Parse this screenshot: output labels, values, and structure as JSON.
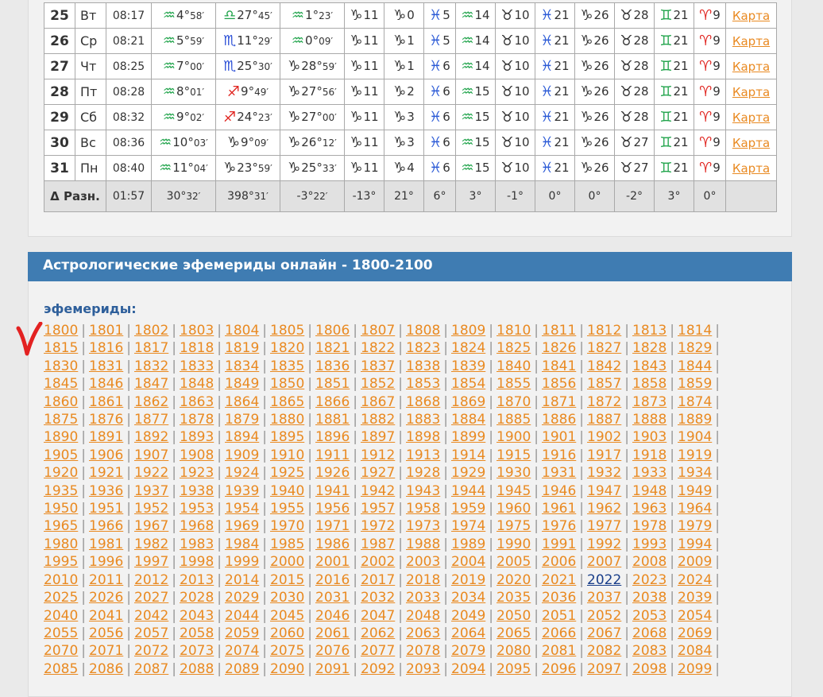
{
  "table": {
    "rows": [
      {
        "day": "25",
        "dow": "Вт",
        "time": "08:17",
        "cells": [
          {
            "sign": "aquarius",
            "deg": "4°",
            "min": "58′"
          },
          {
            "sign": "libra",
            "deg": "27°",
            "min": "45′"
          },
          {
            "sign": "aquarius",
            "deg": "1°",
            "min": "23′"
          },
          {
            "sign": "capricorn",
            "deg": "11",
            "min": ""
          },
          {
            "sign": "capricorn",
            "deg": "0",
            "min": ""
          },
          {
            "sign": "pisces",
            "deg": "5",
            "min": ""
          },
          {
            "sign": "aquarius",
            "deg": "14",
            "min": ""
          },
          {
            "sign": "taurus",
            "deg": "10",
            "min": ""
          },
          {
            "sign": "pisces",
            "deg": "21",
            "min": ""
          },
          {
            "sign": "capricorn",
            "deg": "26",
            "min": ""
          },
          {
            "sign": "taurus",
            "deg": "28",
            "min": ""
          },
          {
            "sign": "gemini",
            "deg": "21",
            "min": ""
          },
          {
            "sign": "aries",
            "deg": "9",
            "min": ""
          }
        ],
        "map": "Карта"
      },
      {
        "day": "26",
        "dow": "Ср",
        "time": "08:21",
        "cells": [
          {
            "sign": "aquarius",
            "deg": "5°",
            "min": "59′"
          },
          {
            "sign": "scorpio",
            "deg": "11°",
            "min": "29′"
          },
          {
            "sign": "aquarius",
            "deg": "0°",
            "min": "09′"
          },
          {
            "sign": "capricorn",
            "deg": "11",
            "min": ""
          },
          {
            "sign": "capricorn",
            "deg": "1",
            "min": ""
          },
          {
            "sign": "pisces",
            "deg": "5",
            "min": ""
          },
          {
            "sign": "aquarius",
            "deg": "14",
            "min": ""
          },
          {
            "sign": "taurus",
            "deg": "10",
            "min": ""
          },
          {
            "sign": "pisces",
            "deg": "21",
            "min": ""
          },
          {
            "sign": "capricorn",
            "deg": "26",
            "min": ""
          },
          {
            "sign": "taurus",
            "deg": "28",
            "min": ""
          },
          {
            "sign": "gemini",
            "deg": "21",
            "min": ""
          },
          {
            "sign": "aries",
            "deg": "9",
            "min": ""
          }
        ],
        "map": "Карта"
      },
      {
        "day": "27",
        "dow": "Чт",
        "time": "08:25",
        "cells": [
          {
            "sign": "aquarius",
            "deg": "7°",
            "min": "00′"
          },
          {
            "sign": "scorpio",
            "deg": "25°",
            "min": "30′"
          },
          {
            "sign": "capricorn",
            "deg": "28°",
            "min": "59′"
          },
          {
            "sign": "capricorn",
            "deg": "11",
            "min": ""
          },
          {
            "sign": "capricorn",
            "deg": "1",
            "min": ""
          },
          {
            "sign": "pisces",
            "deg": "6",
            "min": ""
          },
          {
            "sign": "aquarius",
            "deg": "14",
            "min": ""
          },
          {
            "sign": "taurus",
            "deg": "10",
            "min": ""
          },
          {
            "sign": "pisces",
            "deg": "21",
            "min": ""
          },
          {
            "sign": "capricorn",
            "deg": "26",
            "min": ""
          },
          {
            "sign": "taurus",
            "deg": "28",
            "min": ""
          },
          {
            "sign": "gemini",
            "deg": "21",
            "min": ""
          },
          {
            "sign": "aries",
            "deg": "9",
            "min": ""
          }
        ],
        "map": "Карта"
      },
      {
        "day": "28",
        "dow": "Пт",
        "time": "08:28",
        "cells": [
          {
            "sign": "aquarius",
            "deg": "8°",
            "min": "01′"
          },
          {
            "sign": "sagittarius",
            "deg": "9°",
            "min": "49′"
          },
          {
            "sign": "capricorn",
            "deg": "27°",
            "min": "56′"
          },
          {
            "sign": "capricorn",
            "deg": "11",
            "min": ""
          },
          {
            "sign": "capricorn",
            "deg": "2",
            "min": ""
          },
          {
            "sign": "pisces",
            "deg": "6",
            "min": ""
          },
          {
            "sign": "aquarius",
            "deg": "15",
            "min": ""
          },
          {
            "sign": "taurus",
            "deg": "10",
            "min": ""
          },
          {
            "sign": "pisces",
            "deg": "21",
            "min": ""
          },
          {
            "sign": "capricorn",
            "deg": "26",
            "min": ""
          },
          {
            "sign": "taurus",
            "deg": "28",
            "min": ""
          },
          {
            "sign": "gemini",
            "deg": "21",
            "min": ""
          },
          {
            "sign": "aries",
            "deg": "9",
            "min": ""
          }
        ],
        "map": "Карта"
      },
      {
        "day": "29",
        "dow": "Сб",
        "time": "08:32",
        "cells": [
          {
            "sign": "aquarius",
            "deg": "9°",
            "min": "02′"
          },
          {
            "sign": "sagittarius",
            "deg": "24°",
            "min": "23′"
          },
          {
            "sign": "capricorn",
            "deg": "27°",
            "min": "00′"
          },
          {
            "sign": "capricorn",
            "deg": "11",
            "min": ""
          },
          {
            "sign": "capricorn",
            "deg": "3",
            "min": ""
          },
          {
            "sign": "pisces",
            "deg": "6",
            "min": ""
          },
          {
            "sign": "aquarius",
            "deg": "15",
            "min": ""
          },
          {
            "sign": "taurus",
            "deg": "10",
            "min": ""
          },
          {
            "sign": "pisces",
            "deg": "21",
            "min": ""
          },
          {
            "sign": "capricorn",
            "deg": "26",
            "min": ""
          },
          {
            "sign": "taurus",
            "deg": "28",
            "min": ""
          },
          {
            "sign": "gemini",
            "deg": "21",
            "min": ""
          },
          {
            "sign": "aries",
            "deg": "9",
            "min": ""
          }
        ],
        "map": "Карта"
      },
      {
        "day": "30",
        "dow": "Вс",
        "time": "08:36",
        "cells": [
          {
            "sign": "aquarius",
            "deg": "10°",
            "min": "03′"
          },
          {
            "sign": "capricorn",
            "deg": "9°",
            "min": "09′"
          },
          {
            "sign": "capricorn",
            "deg": "26°",
            "min": "12′"
          },
          {
            "sign": "capricorn",
            "deg": "11",
            "min": ""
          },
          {
            "sign": "capricorn",
            "deg": "3",
            "min": ""
          },
          {
            "sign": "pisces",
            "deg": "6",
            "min": ""
          },
          {
            "sign": "aquarius",
            "deg": "15",
            "min": ""
          },
          {
            "sign": "taurus",
            "deg": "10",
            "min": ""
          },
          {
            "sign": "pisces",
            "deg": "21",
            "min": ""
          },
          {
            "sign": "capricorn",
            "deg": "26",
            "min": ""
          },
          {
            "sign": "taurus",
            "deg": "27",
            "min": ""
          },
          {
            "sign": "gemini",
            "deg": "21",
            "min": ""
          },
          {
            "sign": "aries",
            "deg": "9",
            "min": ""
          }
        ],
        "map": "Карта"
      },
      {
        "day": "31",
        "dow": "Пн",
        "time": "08:40",
        "cells": [
          {
            "sign": "aquarius",
            "deg": "11°",
            "min": "04′"
          },
          {
            "sign": "capricorn",
            "deg": "23°",
            "min": "59′"
          },
          {
            "sign": "capricorn",
            "deg": "25°",
            "min": "33′"
          },
          {
            "sign": "capricorn",
            "deg": "11",
            "min": ""
          },
          {
            "sign": "capricorn",
            "deg": "4",
            "min": ""
          },
          {
            "sign": "pisces",
            "deg": "6",
            "min": ""
          },
          {
            "sign": "aquarius",
            "deg": "15",
            "min": ""
          },
          {
            "sign": "taurus",
            "deg": "10",
            "min": ""
          },
          {
            "sign": "pisces",
            "deg": "21",
            "min": ""
          },
          {
            "sign": "capricorn",
            "deg": "26",
            "min": ""
          },
          {
            "sign": "taurus",
            "deg": "27",
            "min": ""
          },
          {
            "sign": "gemini",
            "deg": "21",
            "min": ""
          },
          {
            "sign": "aries",
            "deg": "9",
            "min": ""
          }
        ],
        "map": "Карта"
      }
    ],
    "diff": {
      "label": "Δ Разн.",
      "time": "01:57",
      "values": [
        {
          "deg": "30°",
          "min": "32′"
        },
        {
          "deg": "398°",
          "min": "31′"
        },
        {
          "deg": "-3°",
          "min": "22′"
        },
        {
          "deg": "-13°",
          "min": ""
        },
        {
          "deg": "21°",
          "min": ""
        },
        {
          "deg": "6°",
          "min": ""
        },
        {
          "deg": "3°",
          "min": ""
        },
        {
          "deg": "-1°",
          "min": ""
        },
        {
          "deg": "0°",
          "min": ""
        },
        {
          "deg": "0°",
          "min": ""
        },
        {
          "deg": "-2°",
          "min": ""
        },
        {
          "deg": "3°",
          "min": ""
        },
        {
          "deg": "0°",
          "min": ""
        }
      ]
    }
  },
  "ephemeris": {
    "title": "Астрологические эфемериды онлайн - 1800-2100",
    "label": "эфемериды:",
    "year_start": 1800,
    "year_end": 2099,
    "years_per_row": 15,
    "current_year": "2022",
    "separator": "|"
  },
  "colors": {
    "header_bg": "#3f7cb2",
    "link": "#e98a22",
    "current_link": "#1a3f8a",
    "label": "#2e5f9b"
  }
}
